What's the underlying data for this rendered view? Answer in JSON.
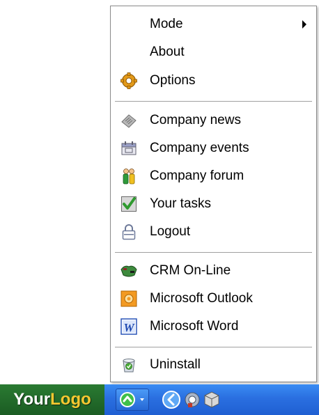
{
  "menu": {
    "items": [
      {
        "label": "Mode",
        "icon": "none",
        "submenu": true
      },
      {
        "label": "About",
        "icon": "none"
      },
      {
        "label": "Options",
        "icon": "gear-icon"
      },
      {
        "label": "Company news",
        "icon": "news-icon"
      },
      {
        "label": "Company events",
        "icon": "calendar-icon"
      },
      {
        "label": "Company forum",
        "icon": "people-icon"
      },
      {
        "label": "Your tasks",
        "icon": "checkmark-icon"
      },
      {
        "label": "Logout",
        "icon": "lock-icon"
      },
      {
        "label": "CRM On-Line",
        "icon": "crm-icon"
      },
      {
        "label": "Microsoft Outlook",
        "icon": "outlook-icon"
      },
      {
        "label": "Microsoft Word",
        "icon": "word-icon"
      },
      {
        "label": "Uninstall",
        "icon": "uninstall-icon"
      }
    ]
  },
  "taskbar": {
    "logo_part1": "Your",
    "logo_part2": "Logo",
    "colors": {
      "taskbar": "#2a6fe0",
      "logo_bg": "#2a7a32",
      "logo_accent": "#f7c830"
    }
  }
}
